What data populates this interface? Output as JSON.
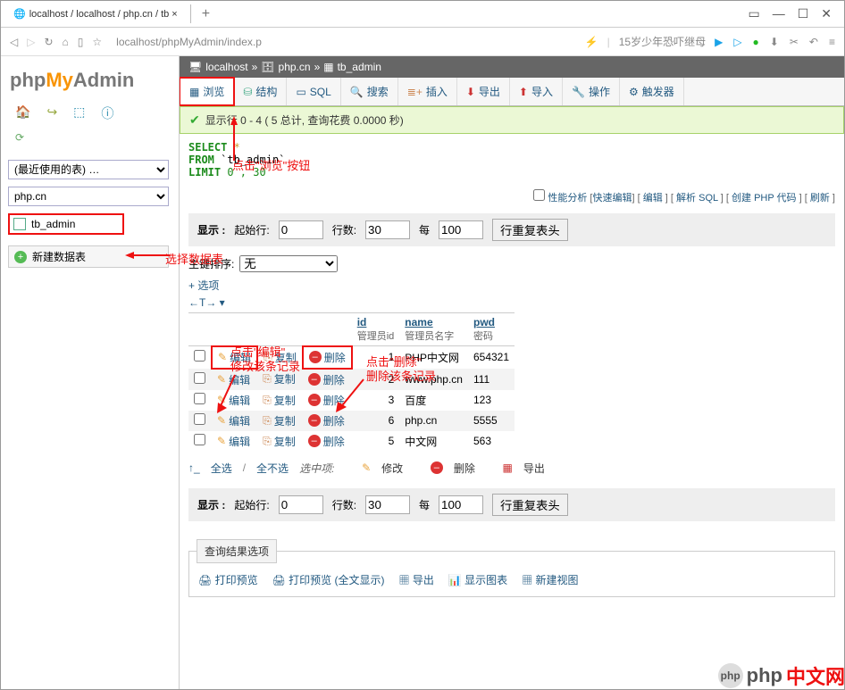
{
  "browser": {
    "tab_title": "localhost / localhost / php.cn / tb ×",
    "url": "localhost/phpMyAdmin/index.p",
    "headline": "15岁少年恐吓继母"
  },
  "logo": {
    "p1": "php",
    "p2": "My",
    "p3": "Admin"
  },
  "sidebar": {
    "recent_select": "(最近使用的表) …",
    "db_select": "php.cn",
    "table_name": "tb_admin",
    "new_table": "新建数据表"
  },
  "annotations": {
    "select_table": "选择数据表",
    "browse_btn": "点击\"浏览\"按钮",
    "edit_title": "点击\"编辑\"",
    "edit_sub": "修改该条记录",
    "delete_title": "点击\"删除\"",
    "delete_sub": "删除该条记录"
  },
  "breadcrumb": {
    "host": "localhost",
    "db": "php.cn",
    "table": "tb_admin"
  },
  "tabs": {
    "browse": "浏览",
    "structure": "结构",
    "sql": "SQL",
    "search": "搜索",
    "insert": "插入",
    "export": "导出",
    "import": "导入",
    "operations": "操作",
    "triggers": "触发器"
  },
  "success": "显示行 0 - 4 ( 5 总计, 查询花费 0.0000 秒)",
  "sql": {
    "select": "SELECT",
    "star": "*",
    "from": "FROM",
    "table": "`tb_admin`",
    "limit": "LIMIT",
    "range": "0 , 30"
  },
  "sql_links": {
    "profiling_cb": "性能分析",
    "inline": "快速编辑",
    "edit": "编辑",
    "explain": "解析 SQL",
    "php": "创建 PHP 代码",
    "refresh": "刷新"
  },
  "display_bar": {
    "show": "显示 :",
    "start_row": "起始行:",
    "start_val": "0",
    "rows": "行数:",
    "rows_val": "30",
    "per": "每",
    "per_val": "100",
    "repeat": "行重复表头"
  },
  "pk_sort": {
    "label": "主键排序:",
    "value": "无"
  },
  "options": "+ 选项",
  "columns": [
    {
      "name": "id",
      "sub": "管理员id"
    },
    {
      "name": "name",
      "sub": "管理员名字"
    },
    {
      "name": "pwd",
      "sub": "密码"
    }
  ],
  "row_actions": {
    "edit": "编辑",
    "copy": "复制",
    "delete": "删除"
  },
  "rows": [
    {
      "id": "1",
      "name": "PHP中文网",
      "pwd": "654321"
    },
    {
      "id": "2",
      "name": "www.php.cn",
      "pwd": "111"
    },
    {
      "id": "3",
      "name": "百度",
      "pwd": "123"
    },
    {
      "id": "6",
      "name": "php.cn",
      "pwd": "5555"
    },
    {
      "id": "5",
      "name": "中文网",
      "pwd": "563"
    }
  ],
  "bulk": {
    "select_all": "全选",
    "unselect_all": "全不选",
    "with_selected": "选中项:",
    "modify": "修改",
    "delete": "删除",
    "export": "导出"
  },
  "results_panel": {
    "title": "查询结果选项",
    "print_preview": "打印预览",
    "print_full": "打印预览 (全文显示)",
    "export": "导出",
    "show_chart": "显示图表",
    "create_view": "新建视图"
  },
  "watermark": {
    "php": "php",
    "cn": "中文网"
  }
}
